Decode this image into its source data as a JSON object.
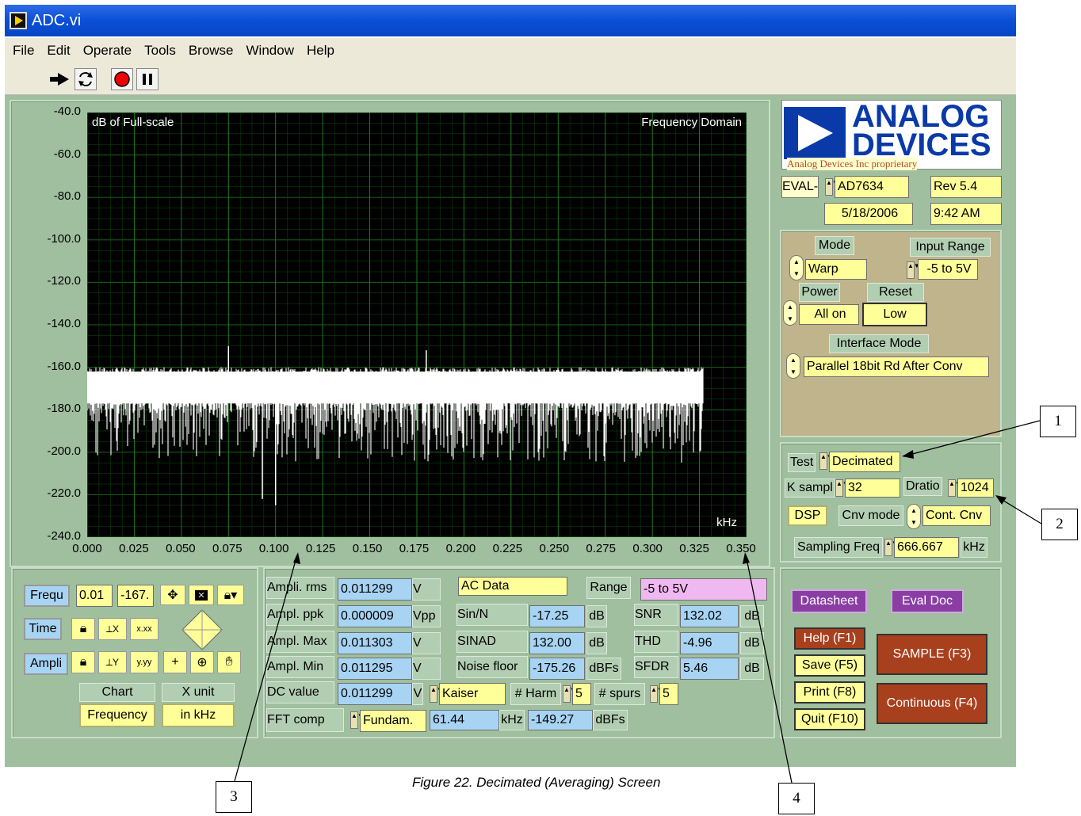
{
  "window": {
    "title": "ADC.vi"
  },
  "menu": [
    "File",
    "Edit",
    "Operate",
    "Tools",
    "Browse",
    "Window",
    "Help"
  ],
  "toolbar": {
    "icons": [
      "run-arrow-icon",
      "run-continuous-icon",
      "abort-icon",
      "pause-icon"
    ]
  },
  "plot": {
    "y_title": "dB of Full-scale",
    "title": "Frequency Domain",
    "x_unit": "kHz",
    "y_ticks": [
      "-40.0",
      "-60.0",
      "-80.0",
      "-100.0",
      "-120.0",
      "-140.0",
      "-160.0",
      "-180.0",
      "-200.0",
      "-220.0",
      "-240.0"
    ],
    "x_ticks": [
      "0.000",
      "0.025",
      "0.050",
      "0.075",
      "0.100",
      "0.125",
      "0.150",
      "0.175",
      "0.200",
      "0.225",
      "0.250",
      "0.275",
      "0.300",
      "0.325",
      "0.350"
    ],
    "xlim": [
      0,
      0.35
    ],
    "ylim": [
      -240,
      -40
    ],
    "noise_floor_db": -175,
    "noise_top_db": -162,
    "trace_end_khz": 0.327,
    "spurs": [
      {
        "x": 0.075,
        "y": -150
      },
      {
        "x": 0.18,
        "y": -152
      },
      {
        "x": 0.1,
        "y": -225
      },
      {
        "x": 0.093,
        "y": -222
      }
    ],
    "trace_color": "#ffffff",
    "grid_color": "#1f7a1f"
  },
  "logo": {
    "name": "ANALOG\nDEVICES",
    "line1": "ANALOG",
    "line2": "DEVICES",
    "proprietary": "Analog Devices Inc proprietary"
  },
  "eval": {
    "prefix": "EVAL-",
    "part": "AD7634",
    "rev": "Rev 5.4",
    "date": "5/18/2006",
    "time": "9:42 AM"
  },
  "config": {
    "mode_label": "Mode",
    "mode_value": "Warp",
    "input_range_label": "Input Range",
    "input_range_value": "-5 to 5V",
    "power_label": "Power",
    "power_value": "All on",
    "reset_label": "Reset",
    "reset_value": "Low",
    "interface_label": "Interface Mode",
    "interface_value": "Parallel 18bit Rd After Conv"
  },
  "test": {
    "test_label": "Test",
    "test_value": "Decimated",
    "ksampl_label": "K sampl",
    "ksampl_value": "32",
    "dratio_label": "Dratio",
    "dratio_value": "1024",
    "dsp_label": "DSP",
    "cnv_mode_label": "Cnv mode",
    "cnv_mode_value": "Cont. Cnv",
    "sampling_label": "Sampling Freq",
    "sampling_value": "666.667",
    "sampling_unit": "kHz"
  },
  "cursor": {
    "frequ_label": "Frequ",
    "frequ_value": "0.01",
    "frequ_value2": "-167.",
    "time_label": "Time",
    "ampli_label": "Ampli",
    "chart_label": "Chart",
    "chart_value": "Frequency",
    "xunit_label": "X unit",
    "xunit_value": "in kHz"
  },
  "measure": {
    "ampl_rms_label": "Ampli. rms",
    "ampl_rms_value": "0.011299",
    "ampl_rms_unit": "V",
    "ampl_ppk_label": "Ampl. ppk",
    "ampl_ppk_value": "0.000009",
    "ampl_ppk_unit": "Vpp",
    "ampl_max_label": "Ampl. Max",
    "ampl_max_value": "0.011303",
    "ampl_max_unit": "V",
    "ampl_min_label": "Ampl. Min",
    "ampl_min_value": "0.011295",
    "ampl_min_unit": "V",
    "dc_label": "DC value",
    "dc_value": "0.011299",
    "dc_unit": "V",
    "window_value": "Kaiser",
    "fft_label": "FFT comp",
    "fft_value": "Fundam.",
    "fft_freq": "61.44",
    "fft_freq_unit": "kHz",
    "fft_db": "-149.27",
    "fft_db_unit": "dBFs",
    "ac_data": "AC Data",
    "range_label": "Range",
    "range_value": "-5 to 5V",
    "sin_label": "Sin/N",
    "sin_value": "-17.25",
    "sin_unit": "dB",
    "sinad_label": "SINAD",
    "sinad_value": "132.00",
    "sinad_unit": "dB",
    "noise_label": "Noise floor",
    "noise_value": "-175.26",
    "noise_unit": "dBFs",
    "harm_label": "# Harm",
    "harm_value": "5",
    "spurs_label": "# spurs",
    "spurs_value": "5",
    "snr_label": "SNR",
    "snr_value": "132.02",
    "snr_unit": "dB",
    "thd_label": "THD",
    "thd_value": "-4.96",
    "thd_unit": "dB",
    "sfdr_label": "SFDR",
    "sfdr_value": "5.46",
    "sfdr_unit": "dB"
  },
  "buttons": {
    "datasheet": "Datasheet",
    "eval_doc": "Eval Doc",
    "help": "Help (F1)",
    "save": "Save (F5)",
    "print": "Print (F8)",
    "quit": "Quit (F10)",
    "sample": "SAMPLE (F3)",
    "continuous": "Continuous (F4)"
  },
  "callouts": [
    "1",
    "2",
    "3",
    "4"
  ],
  "caption": "Figure 22. Decimated (Averaging)  Screen"
}
